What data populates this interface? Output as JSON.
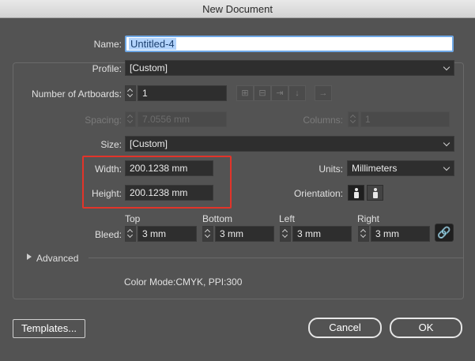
{
  "window": {
    "title": "New Document"
  },
  "name": {
    "label": "Name:",
    "value": "Untitled-4"
  },
  "profile": {
    "label": "Profile:",
    "value": "[Custom]"
  },
  "artboards": {
    "label": "Number of Artboards:",
    "value": "1",
    "arrow": "→"
  },
  "spacing": {
    "label": "Spacing:",
    "value": "7.0556 mm"
  },
  "columns": {
    "label": "Columns:",
    "value": "1"
  },
  "size": {
    "label": "Size:",
    "value": "[Custom]"
  },
  "width": {
    "label": "Width:",
    "value": "200.1238 mm"
  },
  "height": {
    "label": "Height:",
    "value": "200.1238 mm"
  },
  "units": {
    "label": "Units:",
    "value": "Millimeters"
  },
  "orientation": {
    "label": "Orientation:",
    "selected": "portrait"
  },
  "bleed": {
    "label": "Bleed:",
    "top_label": "Top",
    "top": "3 mm",
    "bottom_label": "Bottom",
    "bottom": "3 mm",
    "left_label": "Left",
    "left": "3 mm",
    "right_label": "Right",
    "right": "3 mm",
    "link_icon": "🔗"
  },
  "advanced": {
    "label": "Advanced"
  },
  "color_mode": {
    "text": "Color Mode:CMYK, PPI:300"
  },
  "buttons": {
    "templates": "Templates...",
    "cancel": "Cancel",
    "ok": "OK"
  },
  "colors": {
    "highlight": "#e2342a",
    "focus": "#6fa8e6",
    "background": "#535353"
  }
}
